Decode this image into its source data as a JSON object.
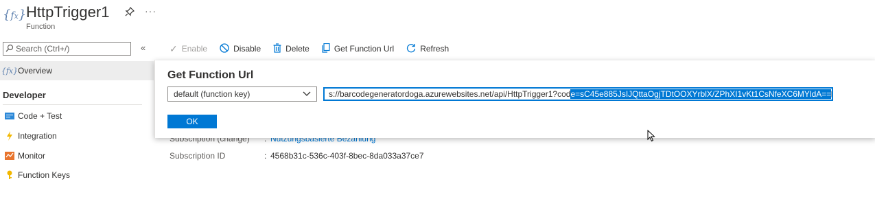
{
  "header": {
    "title": "HttpTrigger1",
    "subtitle": "Function",
    "more": "···"
  },
  "sidebar": {
    "search_placeholder": "Search (Ctrl+/)",
    "overview": "Overview",
    "section": "Developer",
    "items": [
      {
        "label": "Code + Test",
        "icon": "code-icon"
      },
      {
        "label": "Integration",
        "icon": "lightning-icon"
      },
      {
        "label": "Monitor",
        "icon": "monitor-icon"
      },
      {
        "label": "Function Keys",
        "icon": "key-icon"
      }
    ]
  },
  "toolbar": {
    "enable": "Enable",
    "disable": "Disable",
    "delete": "Delete",
    "get_url": "Get Function Url",
    "refresh": "Refresh"
  },
  "properties": {
    "subscription_label": "Subscription (change)",
    "subscription_value": "Nutzungsbasierte Bezahlung",
    "subscription_id_label": "Subscription ID",
    "subscription_id_value": "4568b31c-536c-403f-8bec-8da033a37ce7",
    "separator": ":"
  },
  "popup": {
    "title": "Get Function Url",
    "key_select": "default (function key)",
    "url_unselected": "s://barcodegeneratordoga.azurewebsites.net/api/HttpTrigger1?cod",
    "url_selected": "e=sC45e885JsIJQttaOgjTDtOOXYrblX/ZPhXI1vKt1CsNfeXC6MYldA==",
    "ok": "OK"
  },
  "colors": {
    "accent": "#0078d4",
    "selection": "#0078d4"
  }
}
